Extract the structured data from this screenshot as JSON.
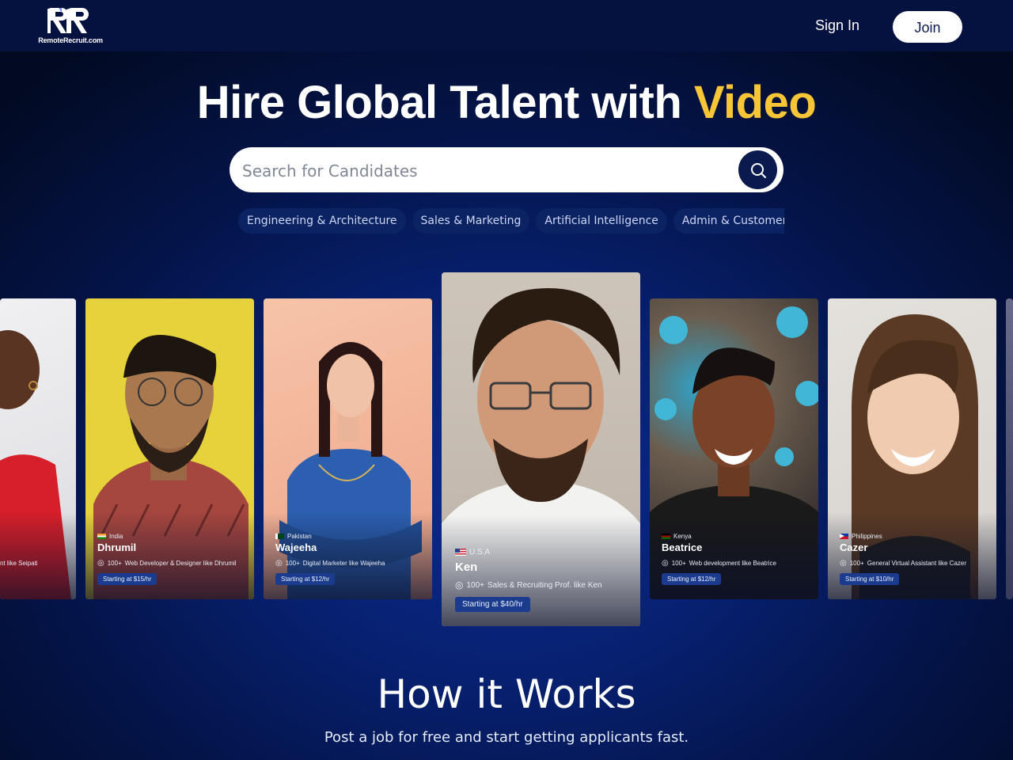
{
  "header": {
    "logo_text": "RemoteRecruit.com",
    "signin_label": "Sign In",
    "join_label": "Join"
  },
  "hero": {
    "title_main": "Hire Global Talent with ",
    "title_accent": "Video",
    "accent_color": "#f7c536"
  },
  "search": {
    "placeholder": "Search for Candidates",
    "icon": "search-icon"
  },
  "categories": [
    "Engineering & Architecture",
    "Sales & Marketing",
    "Artificial Intelligence",
    "Admin & Customer Support"
  ],
  "candidates": [
    {
      "name": "",
      "country": "",
      "role_text": "nt like Seipati",
      "rate": ""
    },
    {
      "name": "Dhrumil",
      "country": "India",
      "role_count": "100+",
      "role_text": "Web Developer & Designer like Dhrumil",
      "rate": "Starting at $15/hr"
    },
    {
      "name": "Wajeeha",
      "country": "Pakistan",
      "role_count": "100+",
      "role_text": "Digital Marketer like Wajeeha",
      "rate": "Starting at $12/hr"
    },
    {
      "name": "Ken",
      "country": "U.S.A",
      "role_count": "100+",
      "role_text": "Sales & Recruiting Prof. like Ken",
      "rate": "Starting at $40/hr"
    },
    {
      "name": "Beatrice",
      "country": "Kenya",
      "role_count": "100+",
      "role_text": "Web development like Beatrice",
      "rate": "Starting at $12/hr"
    },
    {
      "name": "Cazer",
      "country": "Philippines",
      "role_count": "100+",
      "role_text": "General Virtual Assistant like Cazer",
      "rate": "Starting at $10/hr"
    }
  ],
  "how_it_works": {
    "title": "How it Works",
    "subtitle": "Post a job for free and start getting applicants fast."
  }
}
